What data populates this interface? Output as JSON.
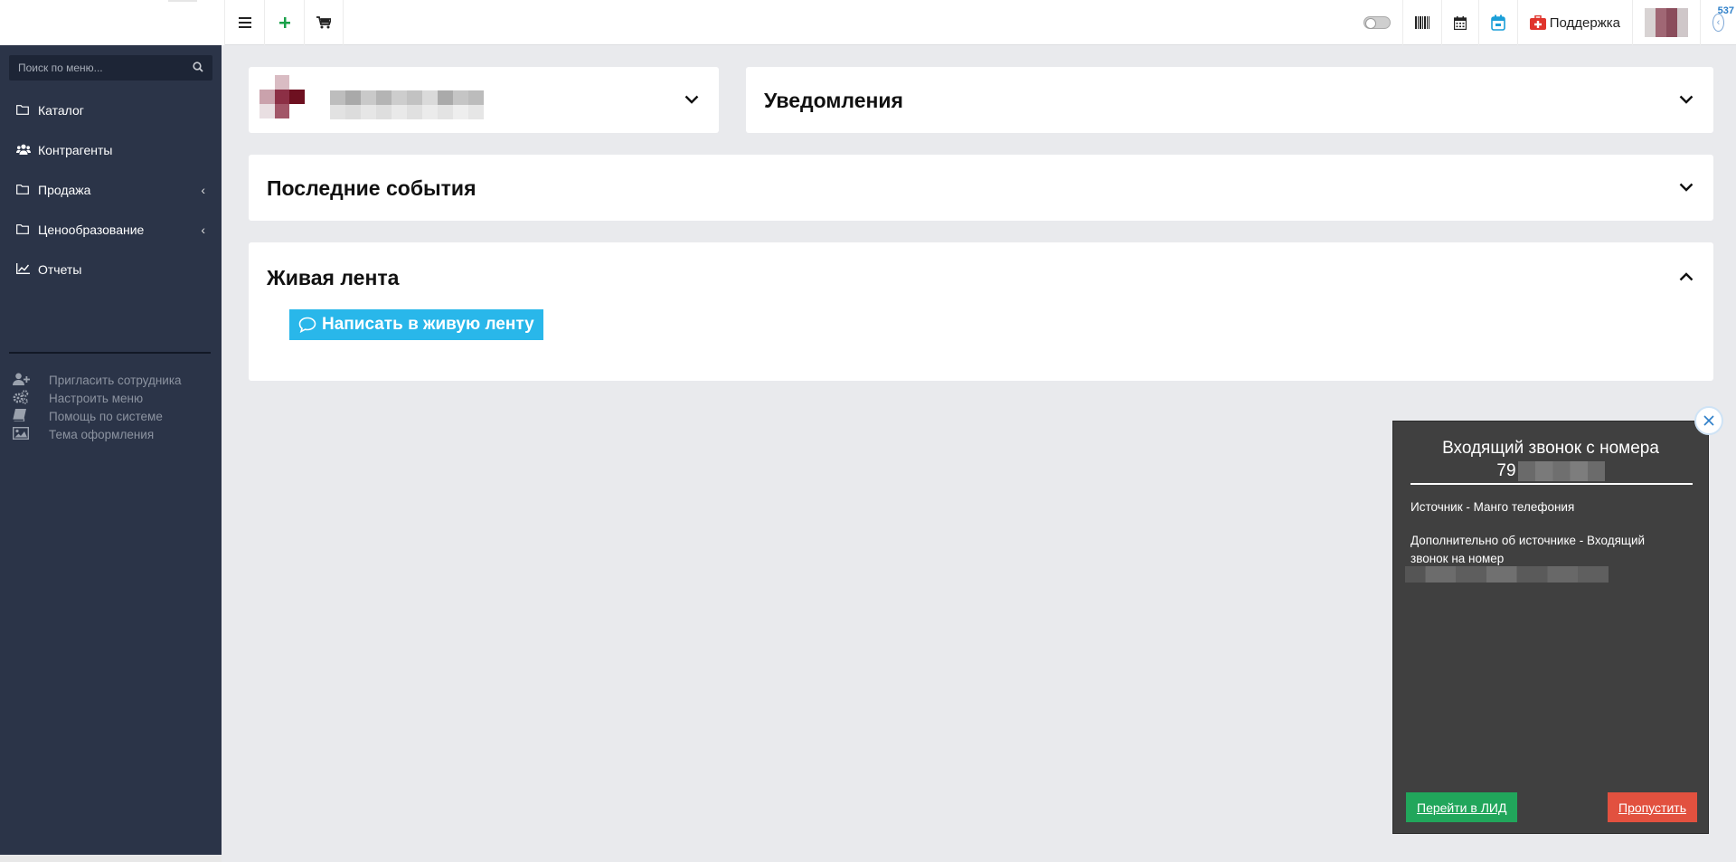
{
  "topbar": {
    "left_buttons": [
      {
        "icon": "menu-icon",
        "glyph": "≡"
      },
      {
        "icon": "plus-icon",
        "glyph": "+"
      },
      {
        "icon": "cart-icon",
        "glyph": "🛒"
      }
    ],
    "support_label": "Поддержка",
    "notification_count": "537"
  },
  "sidebar": {
    "search_placeholder": "Поиск по меню...",
    "items": [
      {
        "label": "Каталог",
        "icon": "folder-icon",
        "has_arrow": false
      },
      {
        "label": "Контрагенты",
        "icon": "users-icon",
        "has_arrow": false
      },
      {
        "label": "Продажа",
        "icon": "folder-icon",
        "has_arrow": true
      },
      {
        "label": "Ценообразование",
        "icon": "folder-icon",
        "has_arrow": true
      },
      {
        "label": "Отчеты",
        "icon": "chart-line-icon",
        "has_arrow": false
      }
    ],
    "tools": [
      {
        "label": "Пригласить сотрудника",
        "icon": "user-plus-icon"
      },
      {
        "label": "Настроить меню",
        "icon": "cogs-icon"
      },
      {
        "label": "Помощь по системе",
        "icon": "book-icon"
      },
      {
        "label": "Тема оформления",
        "icon": "image-icon"
      }
    ]
  },
  "cards": {
    "notifications_title": "Уведомления",
    "events_title": "Последние события",
    "feed_title": "Живая лента",
    "feed_button": "Написать в живую ленту"
  },
  "call": {
    "title": "Входящий звонок с номера",
    "number_prefix": "79",
    "source": "Источник - Манго телефония",
    "extra": "Дополнительно об источнике - Входящий звонок на номер",
    "lead_button": "Перейти в ЛИД",
    "skip_button": "Пропустить"
  },
  "colors": {
    "sidebar_bg": "#2b3448",
    "page_bg": "#e9eaed",
    "accent_blue": "#29b7ea",
    "lead_green": "#21a65b",
    "skip_red": "#e2513f",
    "popup_bg": "#404040"
  }
}
